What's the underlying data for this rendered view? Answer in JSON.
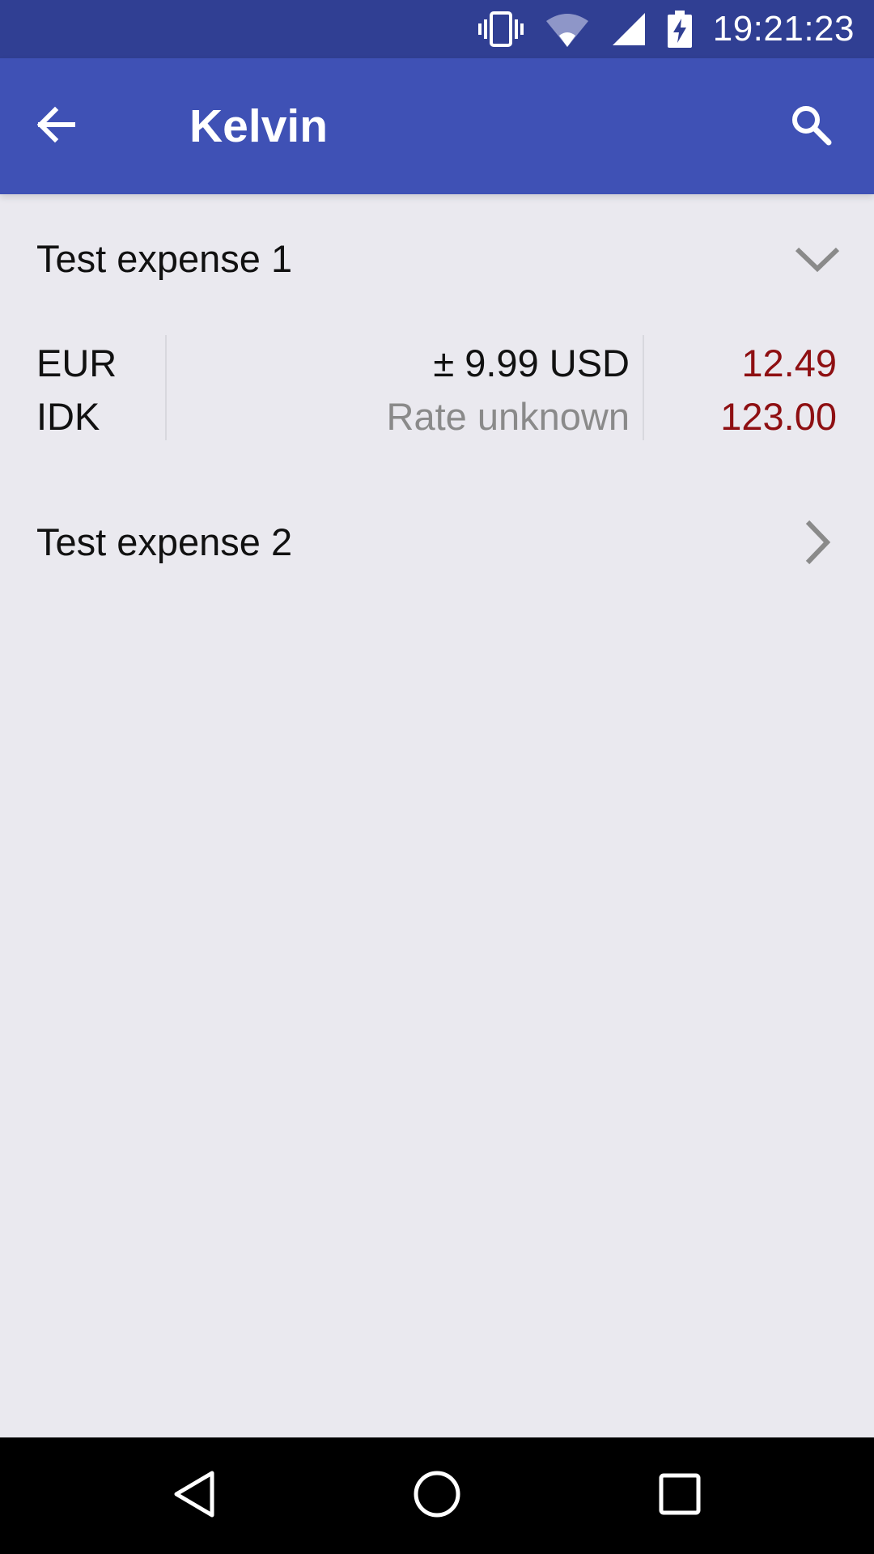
{
  "status_bar": {
    "time": "19:21:23",
    "icons": [
      "vibrate-icon",
      "wifi-icon",
      "signal-icon",
      "battery-charging-icon"
    ]
  },
  "app_bar": {
    "title": "Kelvin",
    "back_icon": "arrow-left-icon",
    "search_icon": "search-icon",
    "color": "#3F51B5",
    "status_color": "#303F93"
  },
  "expenses": [
    {
      "name": "Test expense 1",
      "state_icon": "chevron-down-icon",
      "rows": [
        {
          "currency": "EUR",
          "rate": "± 9.99 USD",
          "amount": "12.49"
        },
        {
          "currency": "IDK",
          "rate": "Rate unknown",
          "amount": "123.00"
        }
      ]
    },
    {
      "name": "Test expense 2",
      "state_icon": "chevron-right-icon"
    }
  ],
  "colors": {
    "background": "#EAE9EF",
    "amount": "#8E0F12",
    "muted_text": "#8A8A8A"
  },
  "nav_bar": {
    "icons": [
      "back-triangle-icon",
      "home-circle-icon",
      "recents-square-icon"
    ]
  }
}
